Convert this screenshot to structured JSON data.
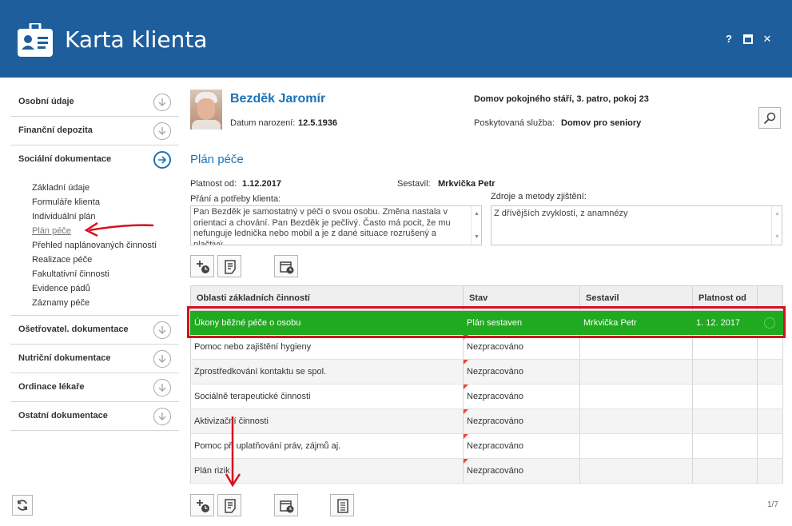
{
  "window": {
    "title": "Karta klienta",
    "help_label": "?",
    "maximize_icon": "maximize-icon",
    "close_label": "✕"
  },
  "sidebar": {
    "sections_top": [
      {
        "label": "Osobní údaje",
        "icon": "chevron-down-circle-icon"
      },
      {
        "label": "Finanční depozita",
        "icon": "chevron-down-circle-icon"
      }
    ],
    "active_section": {
      "label": "Sociální dokumentace",
      "icon": "arrow-right-circle-icon"
    },
    "sub_items": [
      "Základní údaje",
      "Formuláře klienta",
      "Individuální plán",
      "Plán péče",
      "Přehled naplánovaných činností",
      "Realizace péče",
      "Fakultativní činnosti",
      "Evidence pádů",
      "Záznamy péče"
    ],
    "current_sub_index": 3,
    "sections_bottom": [
      {
        "label": "Ošetřovatel. dokumentace",
        "icon": "chevron-down-circle-icon"
      },
      {
        "label": "Nutriční dokumentace",
        "icon": "chevron-down-circle-icon"
      },
      {
        "label": "Ordinace lékaře",
        "icon": "chevron-down-circle-icon"
      },
      {
        "label": "Ostatní dokumentace",
        "icon": "chevron-down-circle-icon"
      }
    ]
  },
  "client": {
    "name": "Bezděk Jaromír",
    "dob_label": "Datum narození:",
    "dob": "12.5.1936",
    "facility": "Domov pokojného stáří, 3. patro, pokoj 23",
    "service_label": "Poskytovaná služba:",
    "service": "Domov pro seniory"
  },
  "plan": {
    "title": "Plán péče",
    "validity_label": "Platnost od:",
    "validity": "1.12.2017",
    "author_label": "Sestavil:",
    "author": "Mrkvička Petr",
    "wishes_label": "Přání a potřeby klienta:",
    "wishes_text": "Pan Bezděk je samostatný v péči o svou osobu. Změna nastala v orientaci a chování. Pan Bezděk je pečlivý. Často má pocit, že mu nefunguje lednička nebo mobil a je z dané situace rozrušený a plačtivý.",
    "sources_label": "Zdroje a metody zjištění:",
    "sources_text": "Z dřívějších zvyklostí, z anamnézy"
  },
  "grid": {
    "columns": [
      "Oblasti základních činností",
      "Stav",
      "Sestavil",
      "Platnost od",
      ""
    ],
    "rows": [
      [
        "Úkony běžné péče o osobu",
        "Plán sestaven",
        "Mrkvička Petr",
        "1. 12. 2017"
      ],
      [
        "Pomoc nebo zajištění hygieny",
        "Nezpracováno",
        "",
        ""
      ],
      [
        "Zprostředkování kontaktu se spol.",
        "Nezpracováno",
        "",
        ""
      ],
      [
        "Sociálně terapeutické činnosti",
        "Nezpracováno",
        "",
        ""
      ],
      [
        "Aktivizační činnosti",
        "Nezpracováno",
        "",
        ""
      ],
      [
        "Pomoc při uplatňování práv, zájmů aj.",
        "Nezpracováno",
        "",
        ""
      ],
      [
        "Plán rizik",
        "Nezpracováno",
        "",
        ""
      ]
    ],
    "selected_row": 0
  },
  "pagination": "1/7",
  "colors": {
    "header_bg": "#1f5e9c",
    "accent": "#1a73b8",
    "selected_row": "#1faa1f",
    "annotation": "#d6101f",
    "status_flag": "#e84a2d"
  }
}
